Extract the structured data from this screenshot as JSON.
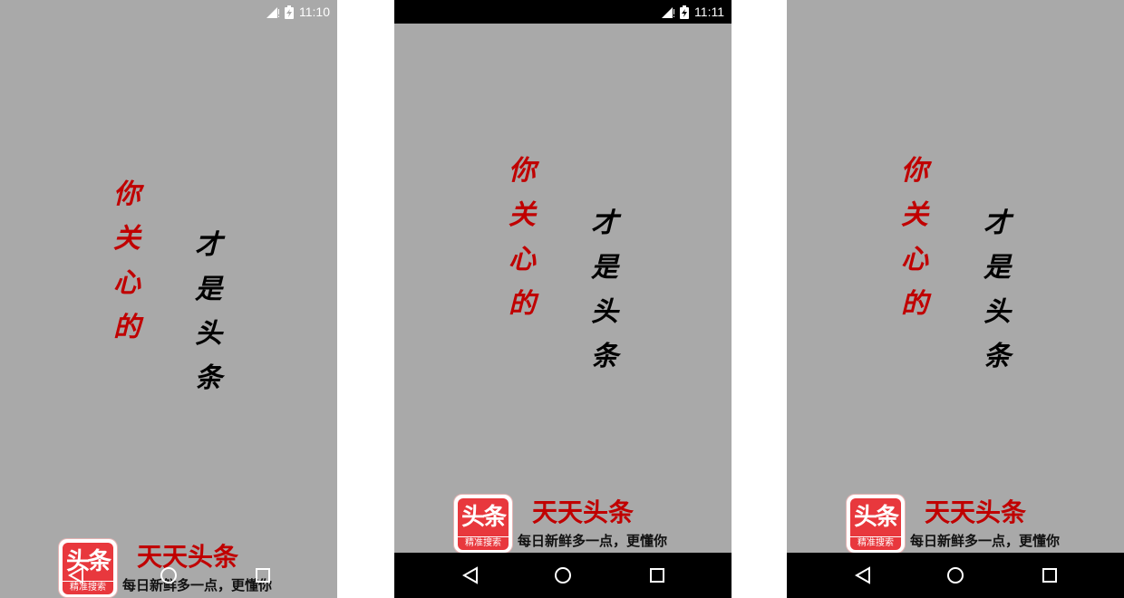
{
  "screens": [
    {
      "status": {
        "time": "11:10",
        "bar_dark": false
      },
      "headline_red": [
        "你",
        "关",
        "心",
        "的"
      ],
      "headline_black": [
        "才",
        "是",
        "头",
        "条"
      ],
      "brand": {
        "logo_main": "头条",
        "logo_sub": "精准搜索",
        "title": "天天头条",
        "slogan": "每日新鲜多一点，更懂你"
      },
      "nav": {
        "bar_dark": false,
        "icons": [
          "back-icon",
          "home-icon",
          "recent-apps-icon"
        ]
      }
    },
    {
      "status": {
        "time": "11:11",
        "bar_dark": true
      },
      "headline_red": [
        "你",
        "关",
        "心",
        "的"
      ],
      "headline_black": [
        "才",
        "是",
        "头",
        "条"
      ],
      "brand": {
        "logo_main": "头条",
        "logo_sub": "精准搜索",
        "title": "天天头条",
        "slogan": "每日新鲜多一点，更懂你"
      },
      "nav": {
        "bar_dark": true,
        "icons": [
          "back-icon",
          "home-icon",
          "recent-apps-icon"
        ]
      }
    },
    {
      "status": {
        "time": "",
        "bar_dark": false
      },
      "headline_red": [
        "你",
        "关",
        "心",
        "的"
      ],
      "headline_black": [
        "才",
        "是",
        "头",
        "条"
      ],
      "brand": {
        "logo_main": "头条",
        "logo_sub": "精准搜索",
        "title": "天天头条",
        "slogan": "每日新鲜多一点，更懂你"
      },
      "nav": {
        "bar_dark": true,
        "icons": [
          "back-icon",
          "home-icon",
          "recent-apps-icon"
        ]
      }
    }
  ],
  "colors": {
    "background": "#a9a9a9",
    "headline_red": "#c00000",
    "headline_black": "#000000",
    "logo_red": "#e8383d",
    "bars": "#000000"
  }
}
